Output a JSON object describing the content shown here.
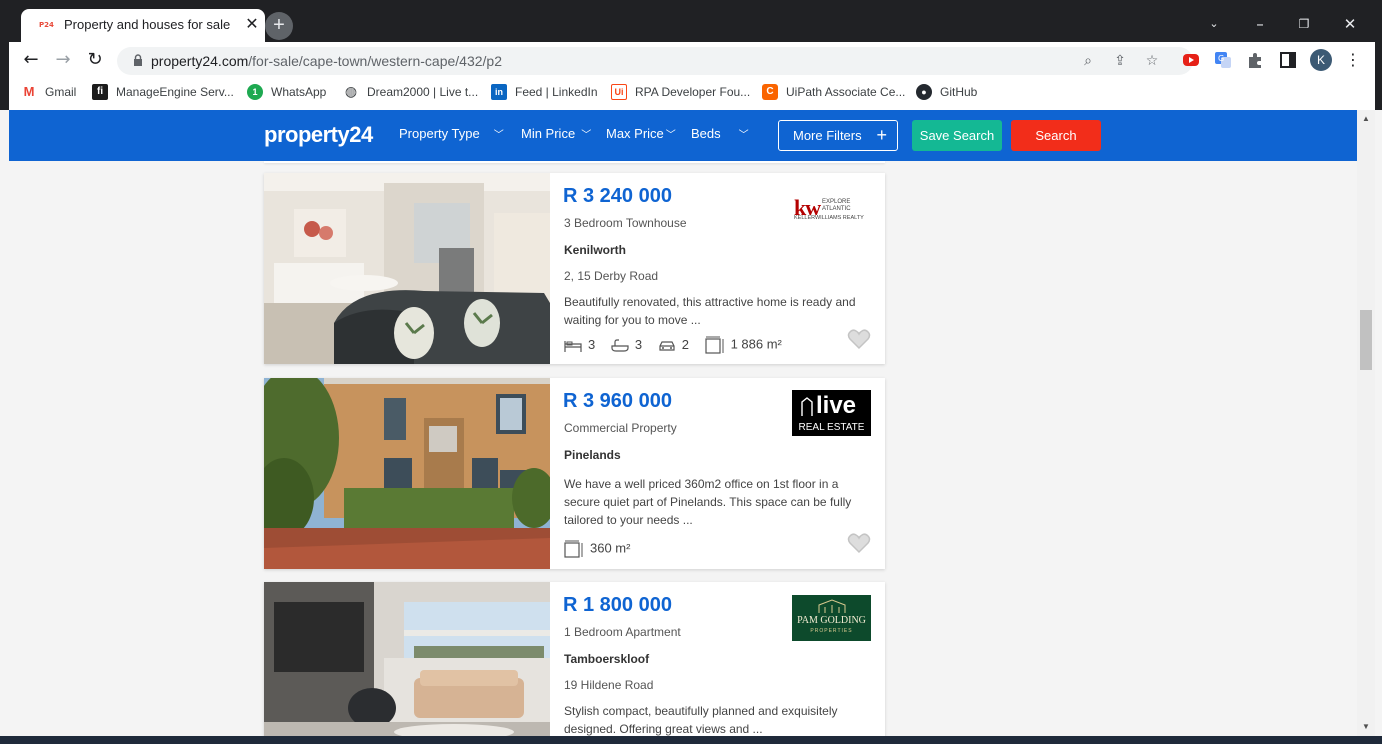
{
  "browser": {
    "tab_title": "Property and houses for sale in C",
    "tab_favicon_text": "P24",
    "url_host": "property24.com",
    "url_path": "/for-sale/cape-town/western-cape/432/p2",
    "bookmarks": [
      {
        "label": "Gmail",
        "icon": "gmail-icon",
        "color": "#ea4335"
      },
      {
        "label": "ManageEngine Serv...",
        "icon": "manageengine-icon",
        "color": "#2b7a0b"
      },
      {
        "label": "WhatsApp",
        "icon": "whatsapp-icon",
        "color": "#25d366"
      },
      {
        "label": "Dream2000 | Live t...",
        "icon": "globe-icon",
        "color": "#5f6368"
      },
      {
        "label": "Feed | LinkedIn",
        "icon": "linkedin-icon",
        "color": "#0a66c2"
      },
      {
        "label": "RPA Developer Fou...",
        "icon": "uipath-icon",
        "color": "#fa4616"
      },
      {
        "label": "UiPath Associate Ce...",
        "icon": "coursera-icon",
        "color": "#fa6400"
      },
      {
        "label": "GitHub",
        "icon": "github-icon",
        "color": "#24292f"
      }
    ],
    "profile_initial": "K"
  },
  "site": {
    "logo": "property24",
    "nav": [
      "Property Type",
      "Min Price",
      "Max Price",
      "Beds"
    ],
    "more_filters": "More Filters",
    "save_search": "Save Search",
    "search": "Search",
    "colors": {
      "brand": "#0f64d2",
      "save": "#14b894",
      "search": "#f22d1a"
    }
  },
  "listings": [
    {
      "price": "R 3 240 000",
      "type": "3 Bedroom Townhouse",
      "suburb": "Kenilworth",
      "address": "2, 15 Derby Road",
      "description": "Beautifully renovated, this attractive home is ready and waiting for you to move ...",
      "beds": "3",
      "baths": "3",
      "parking": "2",
      "size": "1 886 m²",
      "agency": "KELLERWILLIAMS REALTY",
      "agency_mark": "kw",
      "agency_line1": "EXPLORE",
      "agency_line2": "ATLANTIC"
    },
    {
      "price": "R 3 960 000",
      "type": "Commercial Property",
      "suburb": "Pinelands",
      "description": "We have a well priced 360m2 office on 1st floor in a secure quiet part of Pinelands. This space can be fully tailored to your needs ...",
      "size": "360 m²",
      "agency_mark": "live",
      "agency_line2": "REAL ESTATE"
    },
    {
      "price": "R 1 800 000",
      "type": "1 Bedroom Apartment",
      "suburb": "Tamboerskloof",
      "address": "19 Hildene Road",
      "description": "Stylish compact, beautifully planned and exquisitely designed. Offering great views and ...",
      "agency": "PAM GOLDING",
      "agency_line2": "PROPERTIES"
    }
  ]
}
